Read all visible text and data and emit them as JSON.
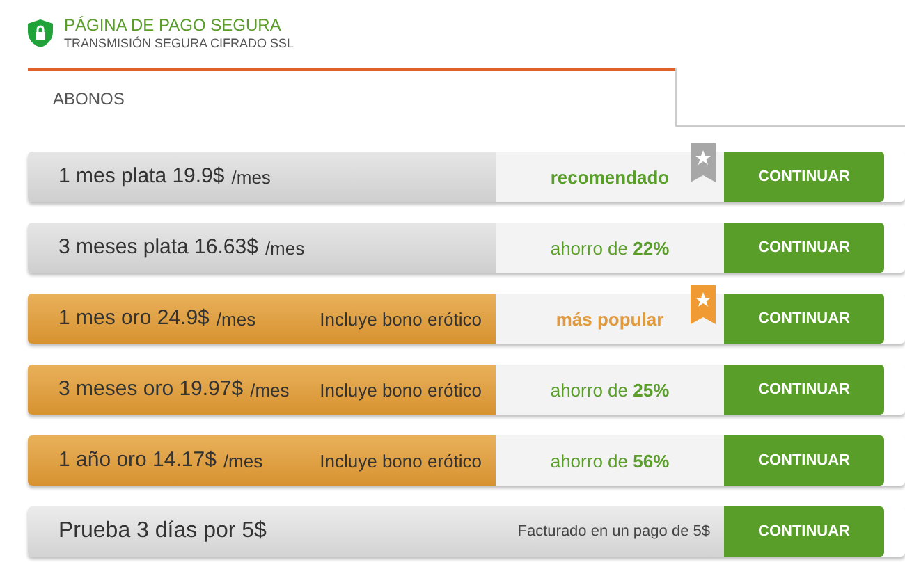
{
  "header": {
    "title": "PÁGINA DE PAGO SEGURA",
    "subtitle": "TRANSMISIÓN SEGURA CIFRADO SSL"
  },
  "tabs": [
    {
      "label": "ABONOS",
      "selected": true
    }
  ],
  "plans": [
    {
      "kind": "silver",
      "name": "1 mes plata 19.9$",
      "unit": "/mes",
      "note": "recomendado",
      "ribbon": true,
      "button": "CONTINUAR"
    },
    {
      "kind": "silver",
      "name": "3 meses plata 16.63$",
      "unit": "/mes",
      "note": "ahorro de **22%**",
      "ribbon": false,
      "button": "CONTINUAR"
    },
    {
      "kind": "gold",
      "name": "1 mes oro 24.9$",
      "unit": "/mes",
      "bonus": "Incluye bono erótico",
      "note": "más popular",
      "ribbon": true,
      "button": "CONTINUAR"
    },
    {
      "kind": "gold",
      "name": "3 meses oro 19.97$",
      "unit": "/mes",
      "bonus": "Incluye bono erótico",
      "note": "ahorro de **25%**",
      "ribbon": false,
      "button": "CONTINUAR"
    },
    {
      "kind": "gold",
      "name": "1 año oro 14.17$",
      "unit": "/mes",
      "bonus": "Incluye bono erótico",
      "note": "ahorro de **56%**",
      "ribbon": false,
      "button": "CONTINUAR"
    },
    {
      "kind": "trial",
      "name": "Prueba 3 días por 5$",
      "note": "Facturado en un pago de 5$",
      "button": "CONTINUAR"
    }
  ]
}
